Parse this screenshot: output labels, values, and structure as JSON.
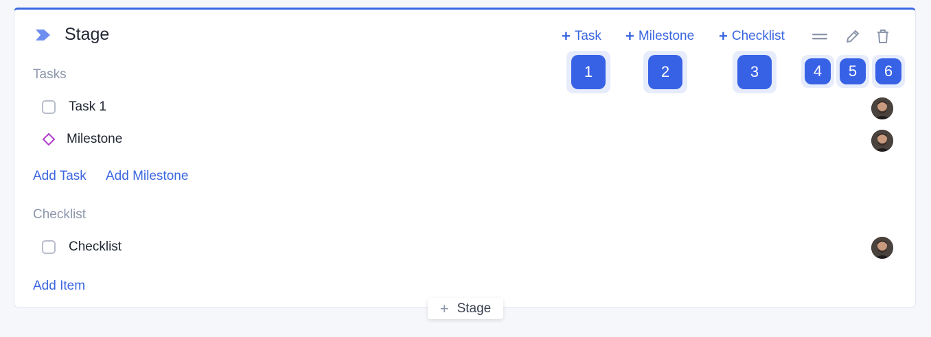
{
  "stage": {
    "title": "Stage",
    "icon": "chevron-flag-icon"
  },
  "toolbar": {
    "add_task": "Task",
    "add_milestone": "Milestone",
    "add_checklist": "Checklist",
    "plus": "+",
    "reorder_icon": "drag-handle-icon",
    "edit_icon": "pencil-icon",
    "delete_icon": "trash-icon"
  },
  "badges": [
    "1",
    "2",
    "3",
    "4",
    "5",
    "6"
  ],
  "tasks": {
    "label": "Tasks",
    "items": [
      {
        "label": "Task 1",
        "kind": "task"
      },
      {
        "label": "Milestone",
        "kind": "milestone"
      }
    ],
    "add_task": "Add Task",
    "add_milestone": "Add Milestone"
  },
  "checklist": {
    "label": "Checklist",
    "items": [
      {
        "label": "Checklist"
      }
    ],
    "add_item": "Add Item"
  },
  "footer": {
    "add_stage_plus": "+",
    "add_stage": "Stage"
  },
  "colors": {
    "accent": "#3b66e0",
    "badge": "#3862e6",
    "milestone": "#b03cc8",
    "muted": "#8c96ab"
  }
}
